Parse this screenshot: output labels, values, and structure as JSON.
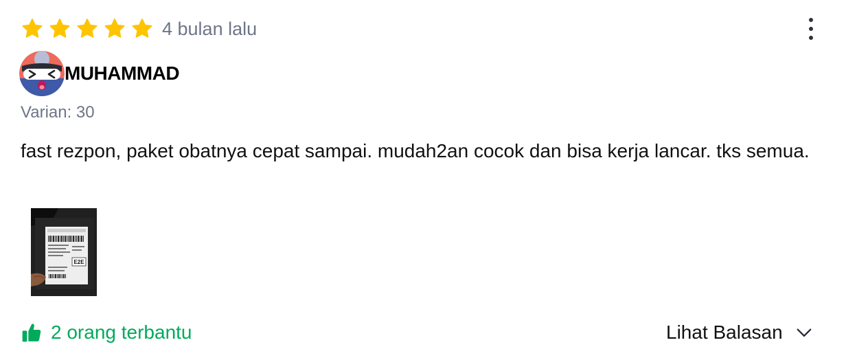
{
  "review": {
    "rating": 5,
    "rating_max": 5,
    "time_ago": "4 bulan lalu",
    "user": {
      "name": "MUHAMMAD",
      "avatar_icon": "ninja-avatar-icon"
    },
    "variant": "Varian: 30",
    "text": "fast rezpon, paket obatnya cepat sampai. mudah2an cocok dan bisa kerja lancar. tks semua.",
    "photo": {
      "label": "E2E"
    },
    "helpful": {
      "text": "2 orang terbantu",
      "icon": "thumbs-up-icon"
    },
    "replies": {
      "text": "Lihat Balasan",
      "icon": "chevron-down-icon"
    },
    "menu_icon": "kebab-menu-icon"
  },
  "colors": {
    "star": "#ffc400",
    "muted": "#6d7588",
    "green": "#00aa5b",
    "text": "#111111"
  }
}
